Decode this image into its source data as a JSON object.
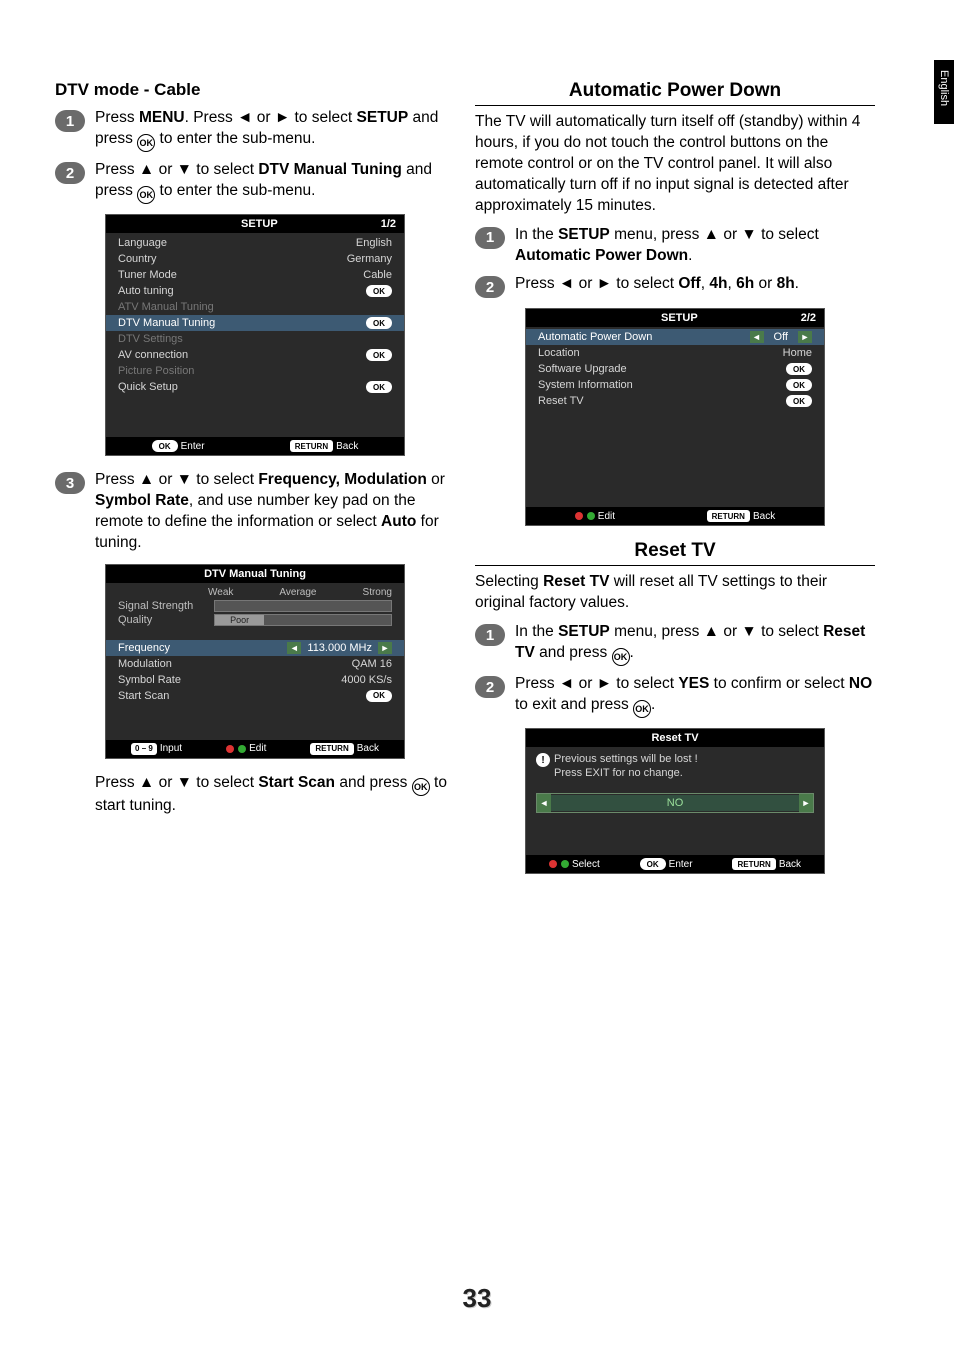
{
  "page": {
    "lang_tab": "English",
    "number": "33"
  },
  "left": {
    "heading": "DTV mode - Cable",
    "steps": {
      "s1": {
        "num": "1",
        "p1a": "Press ",
        "menu": "MENU",
        "p1b": ". Press ◄ or ► to select ",
        "setup": "SETUP",
        "p1c": " and press ",
        "p1d": " to enter  the sub-menu."
      },
      "s2": {
        "num": "2",
        "p2a": "Press ▲ or ▼ to select ",
        "dtv": "DTV Manual Tuning",
        "p2b": " and press ",
        "p2c": " to enter the sub-menu."
      },
      "s3": {
        "num": "3",
        "p3a": "Press ▲ or ▼ to select ",
        "freq": "Frequency, Modulation",
        "or": " or ",
        "sym": "Symbol Rate",
        "p3b": ", and use number key pad on the remote to define the information or select ",
        "auto": "Auto",
        "p3c": " for tuning."
      }
    },
    "finalA": "Press ▲ or ▼ to select ",
    "finalStart": "Start Scan",
    "finalB": " and press ",
    "finalC": " to start tuning.",
    "osd1": {
      "title": "SETUP",
      "page": "1/2",
      "rows": {
        "language": {
          "label": "Language",
          "value": "English"
        },
        "country": {
          "label": "Country",
          "value": "Germany"
        },
        "tuner": {
          "label": "Tuner Mode",
          "value": "Cable"
        },
        "auto": {
          "label": "Auto tuning",
          "value": "OK"
        },
        "atv": {
          "label": "ATV Manual Tuning"
        },
        "dtv": {
          "label": "DTV Manual Tuning",
          "value": "OK"
        },
        "dtvs": {
          "label": "DTV Settings"
        },
        "av": {
          "label": "AV connection",
          "value": "OK"
        },
        "pic": {
          "label": "Picture Position"
        },
        "quick": {
          "label": "Quick Setup",
          "value": "OK"
        }
      },
      "footer": {
        "enter": "Enter",
        "back": "Back",
        "ok": "OK",
        "ret": "RETURN"
      }
    },
    "osd2": {
      "title": "DTV Manual Tuning",
      "labels": {
        "weak": "Weak",
        "avg": "Average",
        "strong": "Strong",
        "sig": "Signal Strength",
        "qual": "Quality",
        "poor": "Poor"
      },
      "rows": {
        "freq": {
          "label": "Frequency",
          "value": "113.000 MHz"
        },
        "mod": {
          "label": "Modulation",
          "value": "QAM 16"
        },
        "sym": {
          "label": "Symbol Rate",
          "value": "4000 KS/s"
        },
        "start": {
          "label": "Start Scan",
          "value": "OK"
        }
      },
      "footer": {
        "input": "Input",
        "edit": "Edit",
        "back": "Back",
        "num": "0 – 9",
        "ret": "RETURN"
      }
    }
  },
  "right": {
    "apd": {
      "title": "Automatic Power Down",
      "desc": "The TV will automatically turn itself off (standby) within 4 hours, if you do not touch the control buttons on the remote control or on the TV control panel. It will also automatically turn off if no input signal is detected after approximately 15 minutes.",
      "s1": {
        "num": "1",
        "a": "In the ",
        "setup": "SETUP",
        "b": " menu, press ▲ or ▼ to select ",
        "apd": "Automatic Power Down",
        "c": "."
      },
      "s2": {
        "num": "2",
        "a": "Press ◄ or ► to select ",
        "off": "Off",
        "c1": ", ",
        "h4": "4h",
        "c2": ", ",
        "h6": "6h",
        "c3": " or ",
        "h8": "8h",
        "c4": "."
      }
    },
    "osd3": {
      "title": "SETUP",
      "page": "2/2",
      "rows": {
        "apd": {
          "label": "Automatic Power Down",
          "value": "Off"
        },
        "loc": {
          "label": "Location",
          "value": "Home"
        },
        "sw": {
          "label": "Software Upgrade",
          "value": "OK"
        },
        "sys": {
          "label": "System Information",
          "value": "OK"
        },
        "reset": {
          "label": "Reset TV",
          "value": "OK"
        }
      },
      "footer": {
        "edit": "Edit",
        "back": "Back",
        "ret": "RETURN"
      }
    },
    "resettv": {
      "title": "Reset TV",
      "descA": "Selecting ",
      "descB": "Reset TV",
      "descC": " will reset all TV settings to their original factory values.",
      "s1": {
        "num": "1",
        "a": "In the ",
        "setup": "SETUP",
        "b": " menu, press ▲ or ▼ to select ",
        "rt": "Reset TV",
        "c": " and press ",
        "d": "."
      },
      "s2": {
        "num": "2",
        "a": "Press ◄ or ► to select ",
        "yes": "YES",
        "b": " to confirm or select ",
        "no": "NO",
        "c": " to exit and press ",
        "d": "."
      }
    },
    "osd4": {
      "title": "Reset TV",
      "warn1": "Previous settings will be lost !",
      "warn2": "Press EXIT for no change.",
      "no": "NO",
      "footer": {
        "select": "Select",
        "enter": "Enter",
        "back": "Back",
        "ok": "OK",
        "ret": "RETURN"
      }
    }
  }
}
